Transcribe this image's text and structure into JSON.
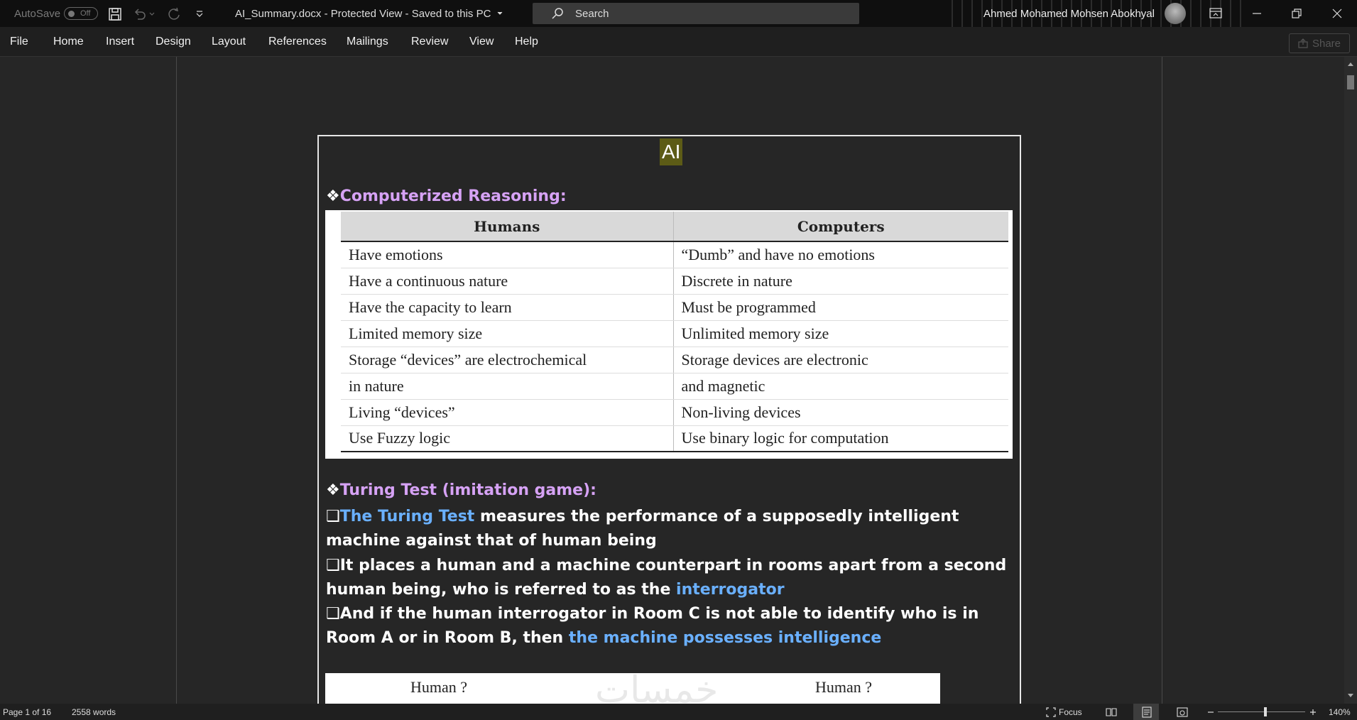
{
  "titlebar": {
    "autosave_label": "AutoSave",
    "autosave_state": "Off",
    "document_title": "AI_Summary.docx  -  Protected View  -  Saved to this PC",
    "search_placeholder": "Search",
    "user_name": "Ahmed Mohamed Mohsen Abokhyal"
  },
  "ribbon": {
    "tabs": [
      "File",
      "Home",
      "Insert",
      "Design",
      "Layout",
      "References",
      "Mailings",
      "Review",
      "View",
      "Help"
    ],
    "share_label": "Share"
  },
  "document": {
    "title": "AI",
    "heading1": "Computerized Reasoning:",
    "table": {
      "headers": [
        "Humans",
        "Computers"
      ],
      "rows": [
        [
          "Have emotions",
          "“Dumb” and have no emotions"
        ],
        [
          "Have a continuous nature",
          "Discrete in nature"
        ],
        [
          "Have the capacity to learn",
          "Must be programmed"
        ],
        [
          "Limited memory size",
          "Unlimited memory size"
        ],
        [
          "Storage “devices” are electrochemical",
          "Storage devices are electronic"
        ],
        [
          "in nature",
          "and magnetic"
        ],
        [
          "Living “devices”",
          "Non-living devices"
        ],
        [
          "Use Fuzzy logic",
          "Use binary logic for computation"
        ]
      ]
    },
    "heading2": "Turing Test (imitation game):",
    "bullets": [
      {
        "highlight_start": "The Turing Test",
        "text": " measures the performance of a supposedly intelligent machine against that of human being"
      },
      {
        "text": "It places a human and a machine counterpart in rooms apart from a second human being, who is referred to as the ",
        "highlight_end": "interrogator"
      },
      {
        "text": "And if the human interrogator in Room C is not able to identify who is in Room A or in Room B, then ",
        "highlight_end": "the machine possesses intelligence"
      }
    ],
    "image_labels": [
      "Human ?",
      "Human ?"
    ],
    "image_watermark": "خمسات"
  },
  "statusbar": {
    "page": "Page 1 of 16",
    "words": "2558 words",
    "focus": "Focus",
    "zoom": "140%"
  },
  "colors": {
    "heading": "#d6a2f5",
    "highlight": "#6ab0ff",
    "title_bg": "#5c5b16"
  }
}
